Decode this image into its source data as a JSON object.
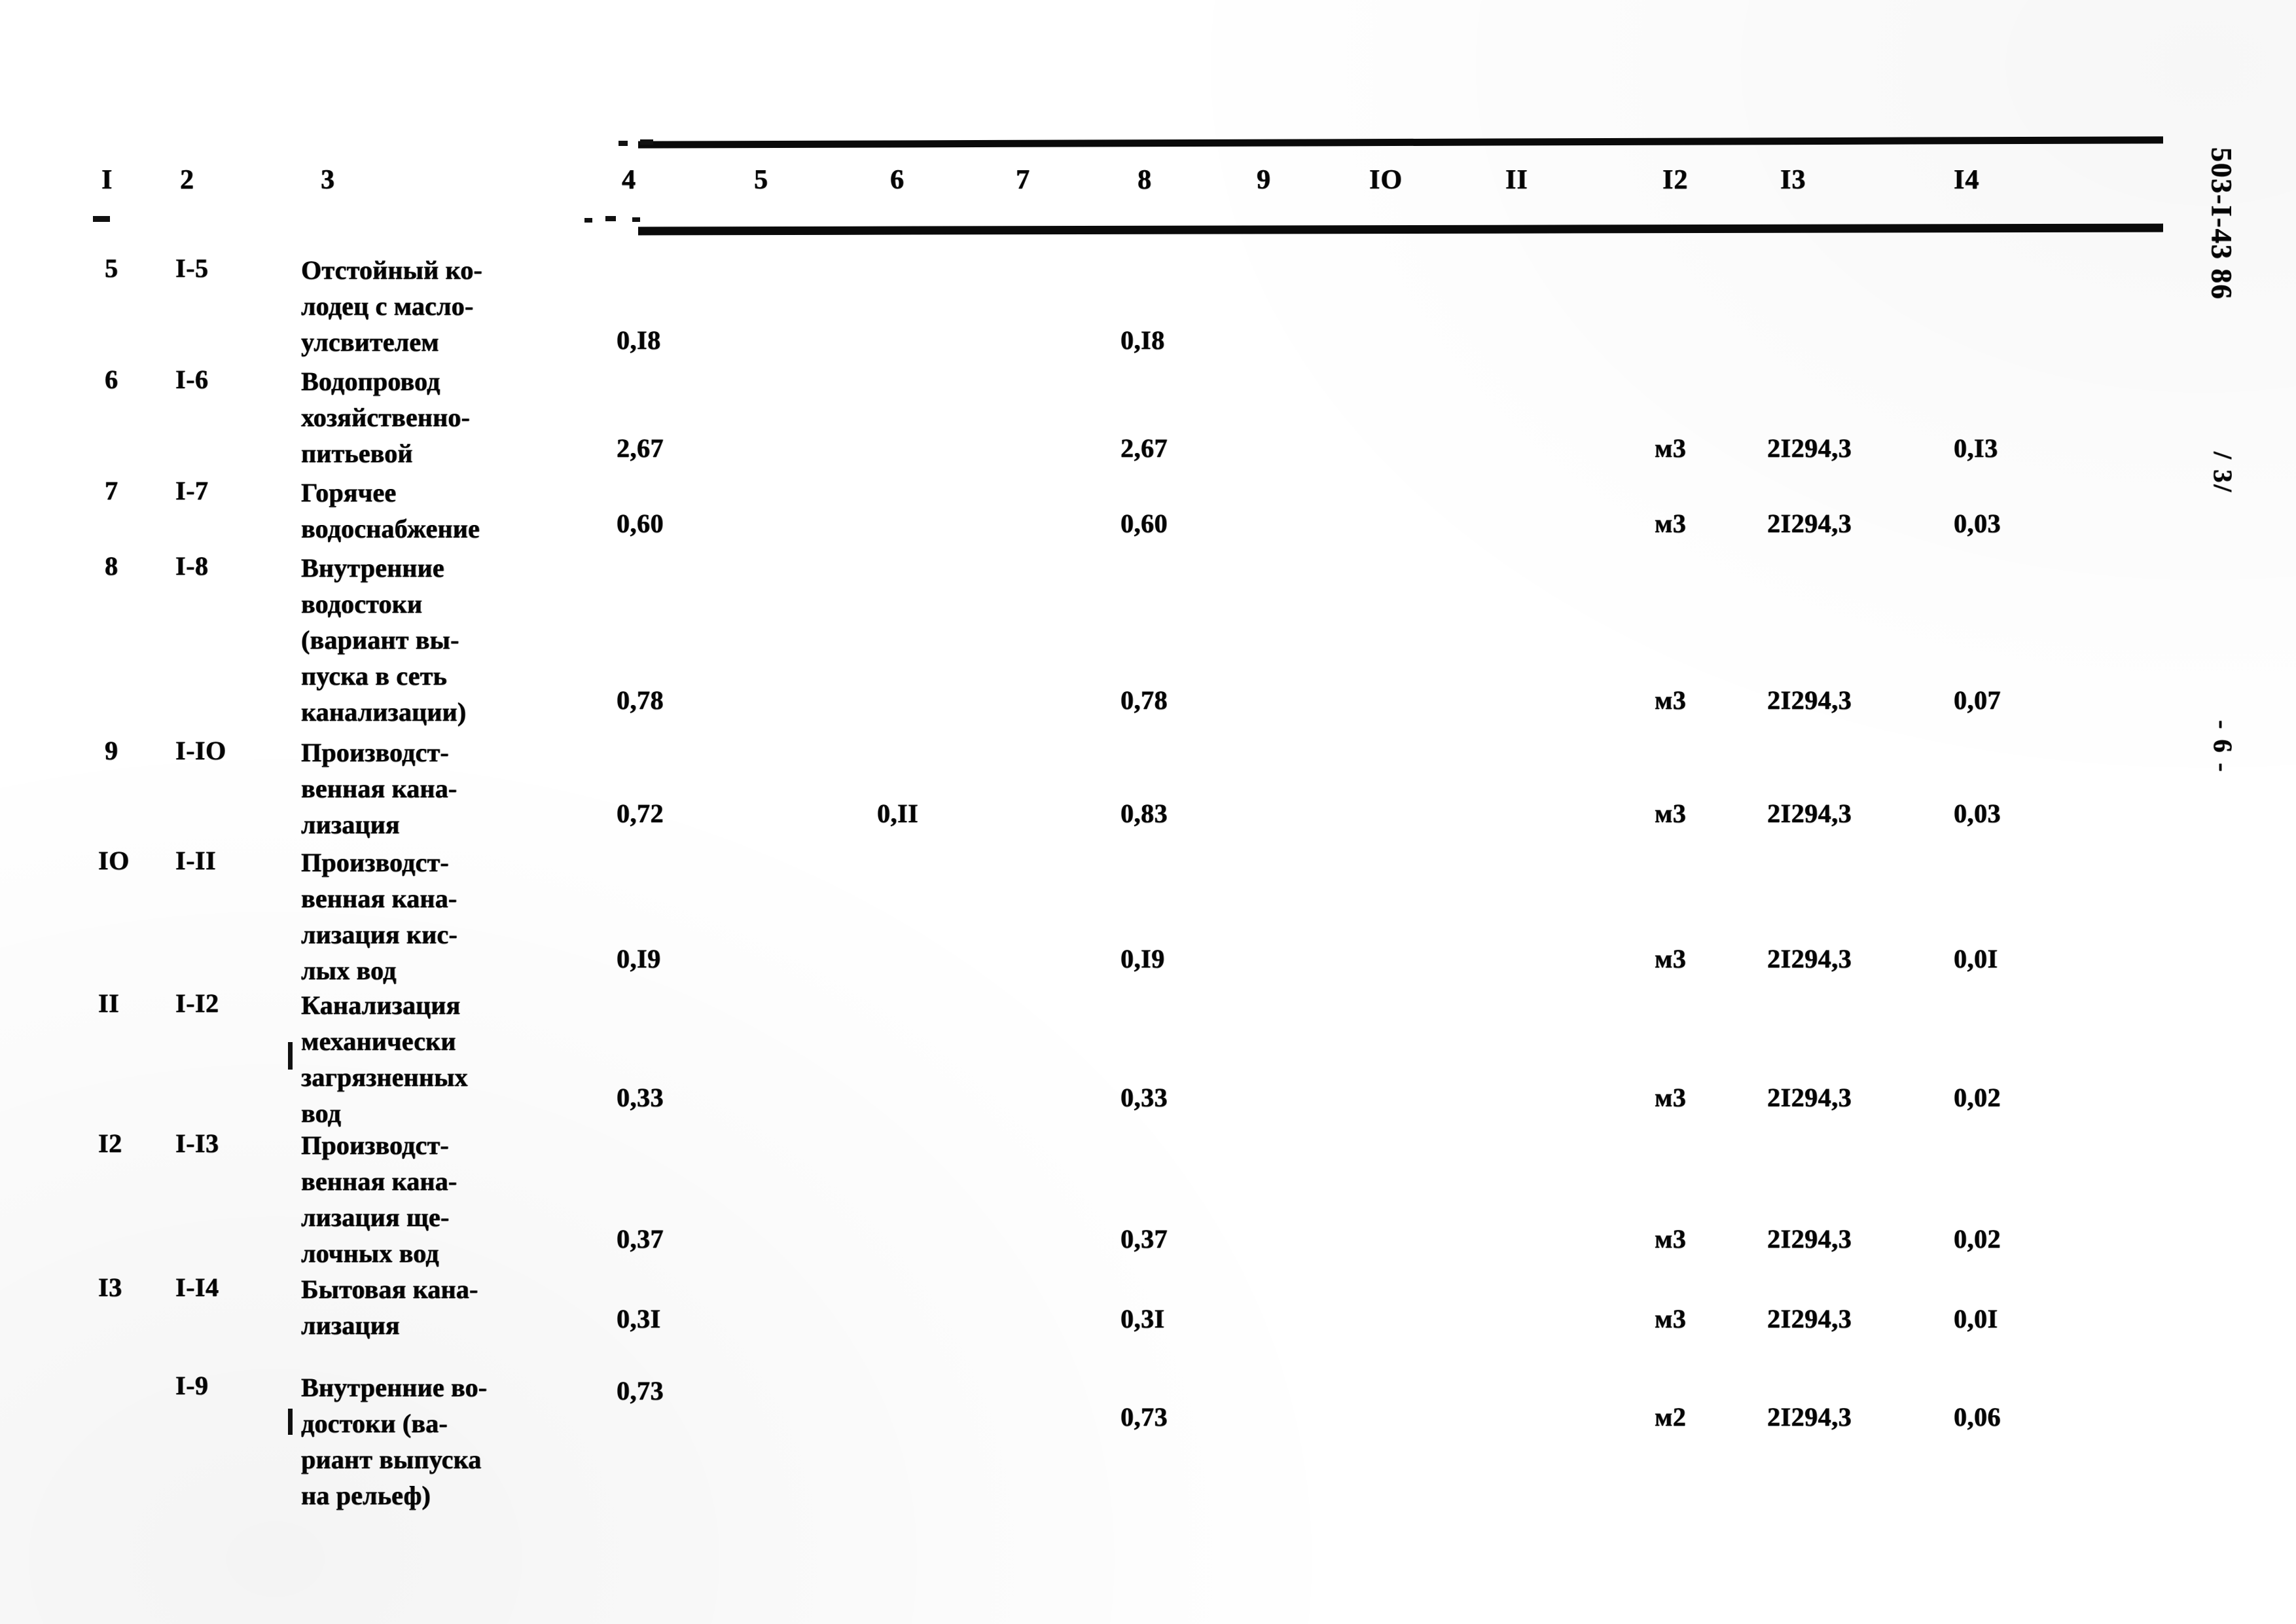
{
  "document": {
    "side_code": "503-I-43 86",
    "side_sheet": "/ 3/",
    "page_number": "- 6 -"
  },
  "table": {
    "column_headers": [
      "I",
      "2",
      "3",
      "4",
      "5",
      "6",
      "7",
      "8",
      "9",
      "IO",
      "II",
      "I2",
      "I3",
      "I4"
    ],
    "rows": [
      {
        "no": "5",
        "code": "I-5",
        "name_lines": [
          "Отстойный ко-",
          "лодец с масло-",
          "улсвителем"
        ],
        "c4": "0,I8",
        "c6": "",
        "c8": "0,I8",
        "c12": "",
        "c13": "",
        "c14": ""
      },
      {
        "no": "6",
        "code": "I-6",
        "name_lines": [
          "Водопровод",
          "хозяйственно-",
          "питьевой"
        ],
        "c4": "2,67",
        "c6": "",
        "c8": "2,67",
        "c12": "м3",
        "c13": "2I294,3",
        "c14": "0,I3"
      },
      {
        "no": "7",
        "code": "I-7",
        "name_lines": [
          "Горячее",
          "водоснабжение"
        ],
        "c4": "0,60",
        "c6": "",
        "c8": "0,60",
        "c12": "м3",
        "c13": "2I294,3",
        "c14": "0,03"
      },
      {
        "no": "8",
        "code": "I-8",
        "name_lines": [
          "Внутренние",
          "водостоки",
          "(вариант вы-",
          "пуска в сеть",
          "канализации)"
        ],
        "c4": "0,78",
        "c6": "",
        "c8": "0,78",
        "c12": "м3",
        "c13": "2I294,3",
        "c14": "0,07"
      },
      {
        "no": "9",
        "code": "I-IO",
        "name_lines": [
          "Производст-",
          "венная кана-",
          "лизация"
        ],
        "c4": "0,72",
        "c6": "0,II",
        "c8": "0,83",
        "c12": "м3",
        "c13": "2I294,3",
        "c14": "0,03"
      },
      {
        "no": "IO",
        "code": "I-II",
        "name_lines": [
          "Производст-",
          "венная кана-",
          "лизация кис-",
          "лых вод"
        ],
        "c4": "0,I9",
        "c6": "",
        "c8": "0,I9",
        "c12": "м3",
        "c13": "2I294,3",
        "c14": "0,0I"
      },
      {
        "no": "II",
        "code": "I-I2",
        "name_lines": [
          "Канализация",
          "механически",
          "загрязненных",
          "вод"
        ],
        "c4": "0,33",
        "c6": "",
        "c8": "0,33",
        "c12": "м3",
        "c13": "2I294,3",
        "c14": "0,02"
      },
      {
        "no": "I2",
        "code": "I-I3",
        "name_lines": [
          "Производст-",
          "венная кана-",
          "лизация ще-",
          "лочных вод"
        ],
        "c4": "0,37",
        "c6": "",
        "c8": "0,37",
        "c12": "м3",
        "c13": "2I294,3",
        "c14": "0,02"
      },
      {
        "no": "I3",
        "code": "I-I4",
        "name_lines": [
          "Бытовая кана-",
          "лизация"
        ],
        "c4": "0,3I",
        "c6": "",
        "c8": "0,3I",
        "c12": "м3",
        "c13": "2I294,3",
        "c14": "0,0I"
      },
      {
        "no": "",
        "code": "I-9",
        "name_lines": [
          "Внутренние во-",
          "достоки (ва-",
          "риант выпуска",
          "на рельеф)"
        ],
        "c4": "0,73",
        "c6": "",
        "c8": "0,73",
        "c12": "м2",
        "c13": "2I294,3",
        "c14": "0,06"
      }
    ]
  }
}
